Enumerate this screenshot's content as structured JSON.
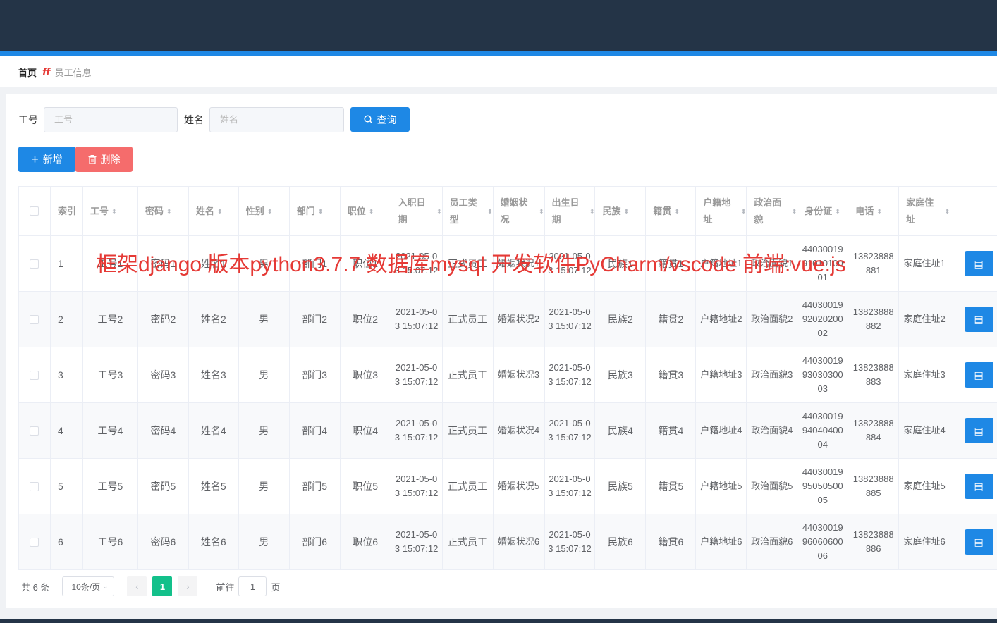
{
  "breadcrumb": {
    "home": "首页",
    "separator": "ﬀ",
    "current": "员工信息"
  },
  "search": {
    "label_id": "工号",
    "placeholder_id": "工号",
    "label_name": "姓名",
    "placeholder_name": "姓名",
    "query_label": "查询",
    "query_icon": "search-icon"
  },
  "actions": {
    "add_label": "新增",
    "add_icon": "plus-icon",
    "delete_label": "删除",
    "delete_icon": "trash-icon"
  },
  "table": {
    "columns": [
      {
        "key": "index",
        "label": "索引",
        "sortable": false
      },
      {
        "key": "id",
        "label": "工号",
        "sortable": true
      },
      {
        "key": "password",
        "label": "密码",
        "sortable": true
      },
      {
        "key": "name",
        "label": "姓名",
        "sortable": true
      },
      {
        "key": "gender",
        "label": "性别",
        "sortable": true
      },
      {
        "key": "dept",
        "label": "部门",
        "sortable": true
      },
      {
        "key": "position",
        "label": "职位",
        "sortable": true
      },
      {
        "key": "hire_date",
        "label": "入职日期",
        "sortable": true
      },
      {
        "key": "emp_type",
        "label": "员工类型",
        "sortable": true
      },
      {
        "key": "marital",
        "label": "婚姻状况",
        "sortable": true
      },
      {
        "key": "birth",
        "label": "出生日期",
        "sortable": true
      },
      {
        "key": "ethnic",
        "label": "民族",
        "sortable": true
      },
      {
        "key": "native",
        "label": "籍贯",
        "sortable": true
      },
      {
        "key": "household",
        "label": "户籍地址",
        "sortable": true
      },
      {
        "key": "political",
        "label": "政治面貌",
        "sortable": true
      },
      {
        "key": "idcard",
        "label": "身份证",
        "sortable": true
      },
      {
        "key": "phone",
        "label": "电话",
        "sortable": true
      },
      {
        "key": "home",
        "label": "家庭住址",
        "sortable": true
      }
    ],
    "rows": [
      [
        "1",
        "工号1",
        "密码1",
        "姓名1",
        "男",
        "部门1",
        "职位1",
        "2021-05-03 15:07:12",
        "正式员工",
        "婚姻状况1",
        "2021-05-03 15:07:12",
        "民族1",
        "籍贯1",
        "户籍地址1",
        "政治面貌1",
        "440300199101010001",
        "13823888881",
        "家庭住址1"
      ],
      [
        "2",
        "工号2",
        "密码2",
        "姓名2",
        "男",
        "部门2",
        "职位2",
        "2021-05-03 15:07:12",
        "正式员工",
        "婚姻状况2",
        "2021-05-03 15:07:12",
        "民族2",
        "籍贯2",
        "户籍地址2",
        "政治面貌2",
        "440300199202020002",
        "13823888882",
        "家庭住址2"
      ],
      [
        "3",
        "工号3",
        "密码3",
        "姓名3",
        "男",
        "部门3",
        "职位3",
        "2021-05-03 15:07:12",
        "正式员工",
        "婚姻状况3",
        "2021-05-03 15:07:12",
        "民族3",
        "籍贯3",
        "户籍地址3",
        "政治面貌3",
        "440300199303030003",
        "13823888883",
        "家庭住址3"
      ],
      [
        "4",
        "工号4",
        "密码4",
        "姓名4",
        "男",
        "部门4",
        "职位4",
        "2021-05-03 15:07:12",
        "正式员工",
        "婚姻状况4",
        "2021-05-03 15:07:12",
        "民族4",
        "籍贯4",
        "户籍地址4",
        "政治面貌4",
        "440300199404040004",
        "13823888884",
        "家庭住址4"
      ],
      [
        "5",
        "工号5",
        "密码5",
        "姓名5",
        "男",
        "部门5",
        "职位5",
        "2021-05-03 15:07:12",
        "正式员工",
        "婚姻状况5",
        "2021-05-03 15:07:12",
        "民族5",
        "籍贯5",
        "户籍地址5",
        "政治面貌5",
        "440300199505050005",
        "13823888885",
        "家庭住址5"
      ],
      [
        "6",
        "工号6",
        "密码6",
        "姓名6",
        "男",
        "部门6",
        "职位6",
        "2021-05-03 15:07:12",
        "正式员工",
        "婚姻状况6",
        "2021-05-03 15:07:12",
        "民族6",
        "籍贯6",
        "户籍地址6",
        "政治面貌6",
        "440300199606060006",
        "13823888886",
        "家庭住址6"
      ]
    ],
    "row_action_icon": "document-icon"
  },
  "pagination": {
    "total_text": "共 6 条",
    "page_size": "10条/页",
    "current_page": "1",
    "goto_label": "前往",
    "goto_value": "1",
    "page_suffix": "页"
  },
  "watermark": "框架django 版本python3.7.7 数据库mysql 开发软件PyCharm/vscode 前端:vue.js",
  "colors": {
    "header": "#243447",
    "accent": "#1e88e5",
    "danger": "#f56c6c",
    "page_active": "#13c08a"
  }
}
